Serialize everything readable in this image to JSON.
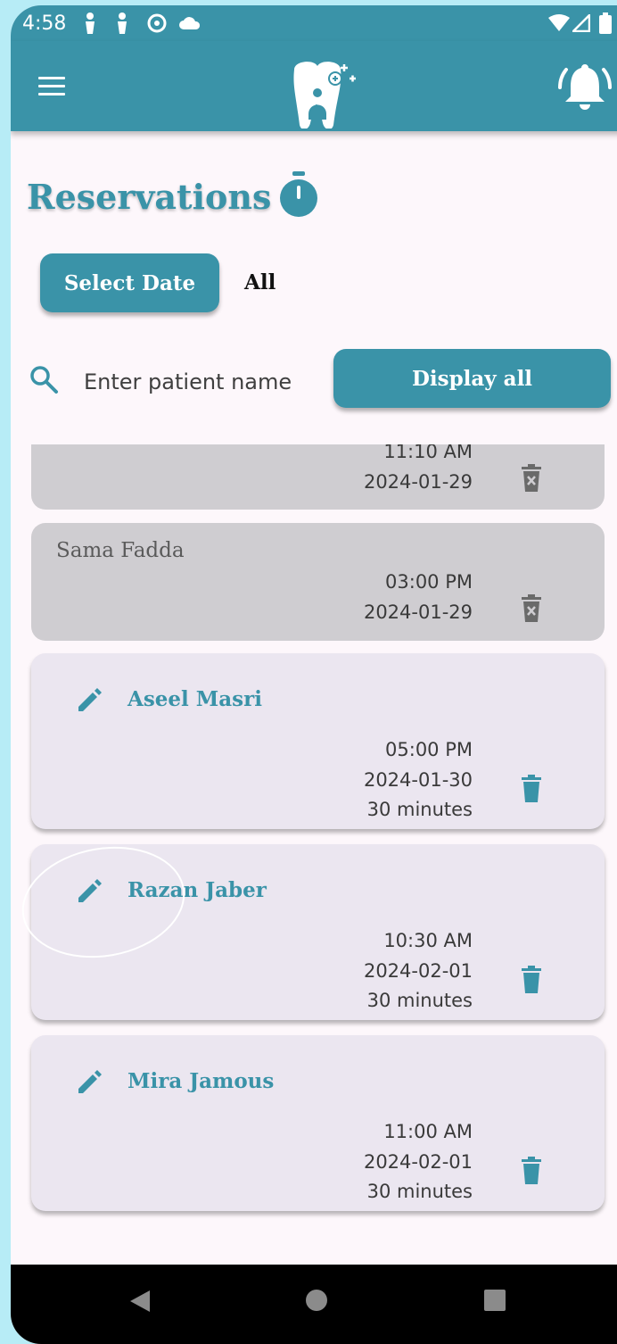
{
  "status_bar": {
    "time": "4:58"
  },
  "header": {
    "menu_icon": "menu-icon",
    "logo_icon": "tooth-logo-icon",
    "notification_icon": "bell-ring-icon"
  },
  "page": {
    "title": "Reservations",
    "title_icon": "timer-icon"
  },
  "controls": {
    "select_date_label": "Select Date",
    "filter_value": "All",
    "search_placeholder": "Enter patient name",
    "display_all_label": "Display all"
  },
  "reservations": [
    {
      "name": "",
      "time": "11:10 AM",
      "date": "2024-01-29",
      "duration": "",
      "state": "past"
    },
    {
      "name": "Sama Fadda",
      "time": "03:00 PM",
      "date": "2024-01-29",
      "duration": "",
      "state": "past"
    },
    {
      "name": "Aseel Masri",
      "time": "05:00 PM",
      "date": "2024-01-30",
      "duration": "30 minutes",
      "state": "active"
    },
    {
      "name": "Razan Jaber",
      "time": "10:30 AM",
      "date": "2024-02-01",
      "duration": "30 minutes",
      "state": "active"
    },
    {
      "name": "Mira Jamous",
      "time": "11:00 AM",
      "date": "2024-02-01",
      "duration": "30 minutes",
      "state": "active"
    }
  ],
  "colors": {
    "primary": "#3a93a8",
    "past_card": "#cfcdd1",
    "active_card": "#ebe6f0",
    "background": "#fdf7fb"
  }
}
